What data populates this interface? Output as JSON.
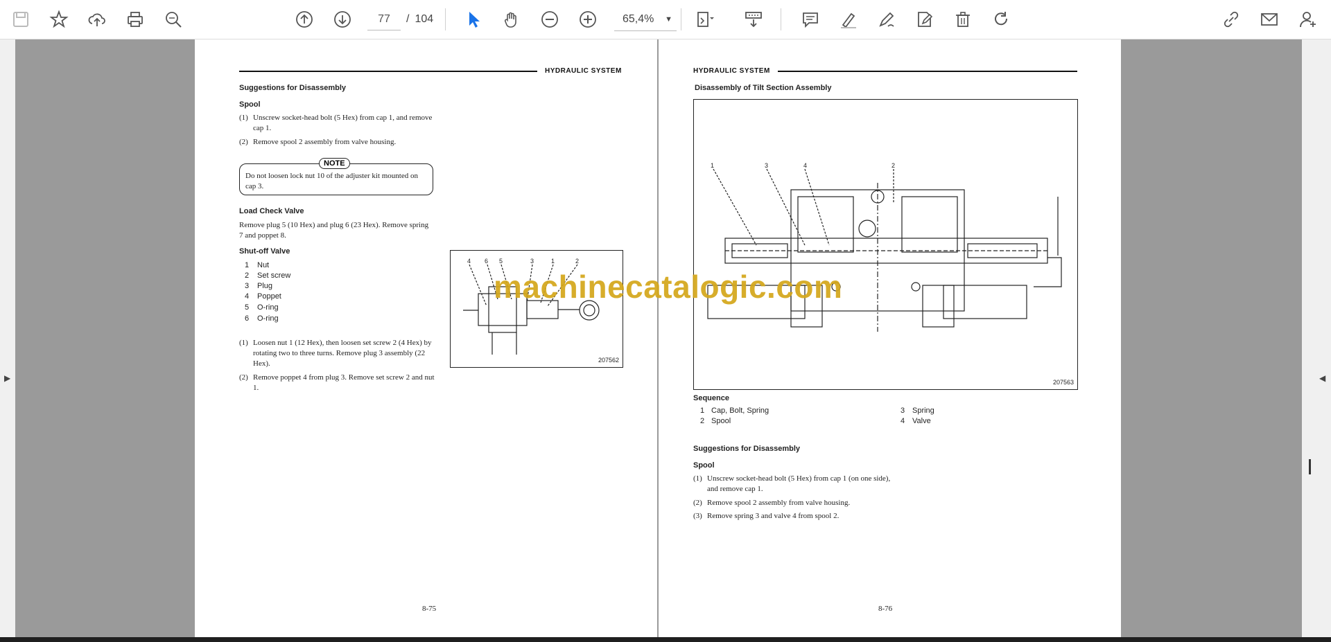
{
  "toolbar": {
    "page_current": "77",
    "page_sep": "/",
    "page_total": "104",
    "zoom": "65,4%"
  },
  "watermark": "machinecatalogic.com",
  "left_page": {
    "header": "HYDRAULIC SYSTEM",
    "suggestions_heading": "Suggestions for Disassembly",
    "spool_heading": "Spool",
    "spool_steps": [
      {
        "num": "(1)",
        "text": "Unscrew socket-head bolt (5 Hex) from cap 1, and remove cap 1."
      },
      {
        "num": "(2)",
        "text": "Remove spool 2 assembly from valve housing."
      }
    ],
    "note_label": "NOTE",
    "note_text": "Do not loosen lock nut 10 of the adjuster kit mounted on cap 3.",
    "load_check_heading": "Load Check Valve",
    "load_check_text": "Remove plug 5 (10 Hex) and plug 6 (23 Hex).  Remove spring 7 and poppet 8.",
    "shutoff_heading": "Shut-off Valve",
    "parts": [
      {
        "num": "1",
        "name": "Nut"
      },
      {
        "num": "2",
        "name": "Set screw"
      },
      {
        "num": "3",
        "name": "Plug"
      },
      {
        "num": "4",
        "name": "Poppet"
      },
      {
        "num": "5",
        "name": "O-ring"
      },
      {
        "num": "6",
        "name": "O-ring"
      }
    ],
    "shutoff_steps": [
      {
        "num": "(1)",
        "text": "Loosen nut 1 (12 Hex), then loosen set screw 2 (4 Hex) by rotating two to three turns.  Remove plug 3 assembly (22 Hex)."
      },
      {
        "num": "(2)",
        "text": "Remove poppet 4 from plug 3.  Remove set screw 2 and nut 1."
      }
    ],
    "figure_callouts": [
      "4",
      "6",
      "5",
      "3",
      "1",
      "2"
    ],
    "figure_number": "207562",
    "page_number": "8-75"
  },
  "right_page": {
    "header": "HYDRAULIC SYSTEM",
    "title": "Disassembly of Tilt Section Assembly",
    "figure_callouts": [
      "1",
      "3",
      "4",
      "2"
    ],
    "figure_number": "207563",
    "sequence_heading": "Sequence",
    "sequence": [
      {
        "num": "1",
        "name": "Cap, Bolt, Spring"
      },
      {
        "num": "2",
        "name": "Spool"
      },
      {
        "num": "3",
        "name": "Spring"
      },
      {
        "num": "4",
        "name": "Valve"
      }
    ],
    "suggestions_heading": "Suggestions for Disassembly",
    "spool_heading": "Spool",
    "spool_steps": [
      {
        "num": "(1)",
        "text": "Unscrew socket-head bolt (5 Hex) from cap 1 (on one side), and remove cap 1."
      },
      {
        "num": "(2)",
        "text": "Remove spool 2 assembly from valve housing."
      },
      {
        "num": "(3)",
        "text": "Remove spring 3 and valve 4 from spool 2."
      }
    ],
    "page_number": "8-76"
  }
}
